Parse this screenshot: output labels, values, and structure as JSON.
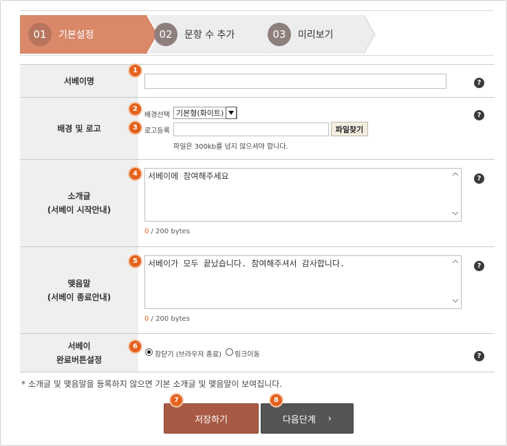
{
  "steps": [
    {
      "num": "01",
      "label": "기본설정"
    },
    {
      "num": "02",
      "label": "문항 수 추가"
    },
    {
      "num": "03",
      "label": "미리보기"
    }
  ],
  "rows": {
    "title": {
      "label": "서베이명",
      "badge": "1",
      "value": ""
    },
    "background": {
      "label": "배경 및 로고",
      "bg_badge": "2",
      "bg_label": "배경선택",
      "bg_value": "기본형(화이트)",
      "logo_badge": "3",
      "logo_label": "로고등록",
      "logo_value": "",
      "file_button": "파일찾기",
      "hint": "파일은 300kb를 넘지 않으셔야 합니다."
    },
    "intro": {
      "label_line1": "소개글",
      "label_line2": "(서베이 시작안내)",
      "badge": "4",
      "text": "서베이에 참여해주세요",
      "count": "0",
      "max": " / 200 bytes"
    },
    "closing": {
      "label_line1": "맺음말",
      "label_line2": "(서베이 종료안내)",
      "badge": "5",
      "text": "서베이가 모두 끝났습니다. 참여해주셔서 감사합니다.",
      "count": "0",
      "max": " / 200 bytes"
    },
    "complete": {
      "label_line1": "서베이",
      "label_line2": "완료버튼설정",
      "badge": "6",
      "option1": "창닫기 (브라우저 종료)",
      "option2": "링크이동",
      "selected": "option1"
    }
  },
  "help_symbol": "?",
  "note": "* 소개글 및 맺음말을 등록하지 않으면 기본 소개글 및 맺음말이 보여집니다.",
  "buttons": {
    "save": {
      "label": "저장하기",
      "badge": "7"
    },
    "next": {
      "label": "다음단계",
      "arrow": "›",
      "badge": "8"
    }
  },
  "colors": {
    "accent": "#e5611c",
    "active_step": "#d9886a",
    "save_button": "#a85a45",
    "next_button": "#555555"
  }
}
